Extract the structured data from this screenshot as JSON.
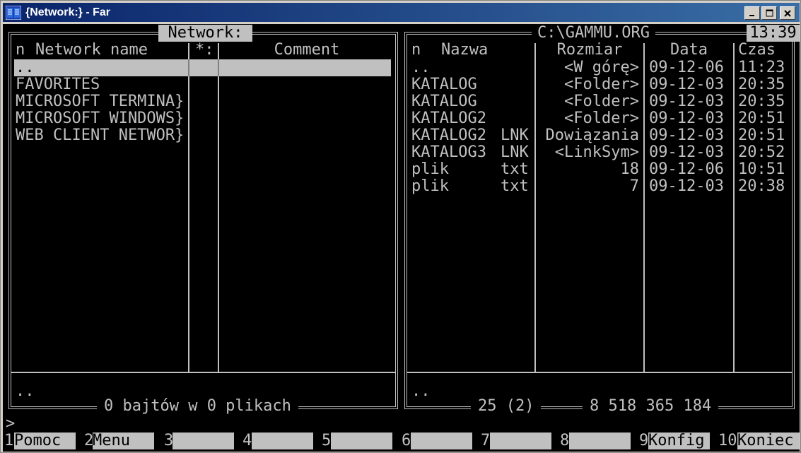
{
  "window": {
    "title": "{Network:} - Far",
    "icon": "far-manager-icon"
  },
  "left_panel": {
    "title": "Network:",
    "headers": {
      "n": "n",
      "name": "Network name",
      "attr": "*:",
      "comment": "Comment"
    },
    "rows": [
      {
        "name": "..",
        "attr": "",
        "comment": ""
      },
      {
        "name": "FAVORITES",
        "attr": "",
        "comment": ""
      },
      {
        "name": "MICROSOFT TERMINA}",
        "attr": "",
        "comment": ""
      },
      {
        "name": "MICROSOFT WINDOWS}",
        "attr": "",
        "comment": ""
      },
      {
        "name": "WEB CLIENT NETWOR}",
        "attr": "",
        "comment": ""
      }
    ],
    "current_item": "..",
    "footer": "0 bajtów w 0 plikach"
  },
  "right_panel": {
    "title": "C:\\GAMMU.ORG",
    "clock": "13:39",
    "headers": {
      "n": "n",
      "name": "Nazwa",
      "size": "Rozmiar",
      "date": "Data",
      "time": "Czas"
    },
    "rows": [
      {
        "name": "..",
        "ext": "",
        "size": "<W górę>",
        "date": "09-12-06",
        "time": "11:23"
      },
      {
        "name": "KATALOG",
        "ext": "",
        "size": "<Folder>",
        "date": "09-12-03",
        "time": "20:35"
      },
      {
        "name": "KATALOG",
        "ext": "",
        "size": "<Folder>",
        "date": "09-12-03",
        "time": "20:35"
      },
      {
        "name": "KATALOG2",
        "ext": "",
        "size": "<Folder>",
        "date": "09-12-03",
        "time": "20:51"
      },
      {
        "name": "KATALOG2",
        "ext": "LNK",
        "size": "Dowiązania",
        "date": "09-12-03",
        "time": "20:51"
      },
      {
        "name": "KATALOG3",
        "ext": "LNK",
        "size": "<LinkSym>",
        "date": "09-12-03",
        "time": "20:52"
      },
      {
        "name": "plik",
        "ext": "txt",
        "size": "18",
        "date": "09-12-06",
        "time": "10:51"
      },
      {
        "name": "plik",
        "ext": "txt",
        "size": "7",
        "date": "09-12-03",
        "time": "20:38"
      }
    ],
    "current_item": "..",
    "footer_count": "25 (2)",
    "footer_bytes": "8 518 365 184"
  },
  "command_line": {
    "prompt": ">",
    "value": ""
  },
  "fkeys": [
    {
      "num": "1",
      "label": "Pomoc"
    },
    {
      "num": "2",
      "label": "Menu"
    },
    {
      "num": "3",
      "label": ""
    },
    {
      "num": "4",
      "label": ""
    },
    {
      "num": "5",
      "label": ""
    },
    {
      "num": "6",
      "label": ""
    },
    {
      "num": "7",
      "label": ""
    },
    {
      "num": "8",
      "label": ""
    },
    {
      "num": "9",
      "label": "Konfig"
    },
    {
      "num": "10",
      "label": "Koniec"
    }
  ],
  "colors": {
    "background": "#000000",
    "text": "#c0c0c0",
    "highlight": "#c0c0c0",
    "titlebar": "#0a246a"
  }
}
